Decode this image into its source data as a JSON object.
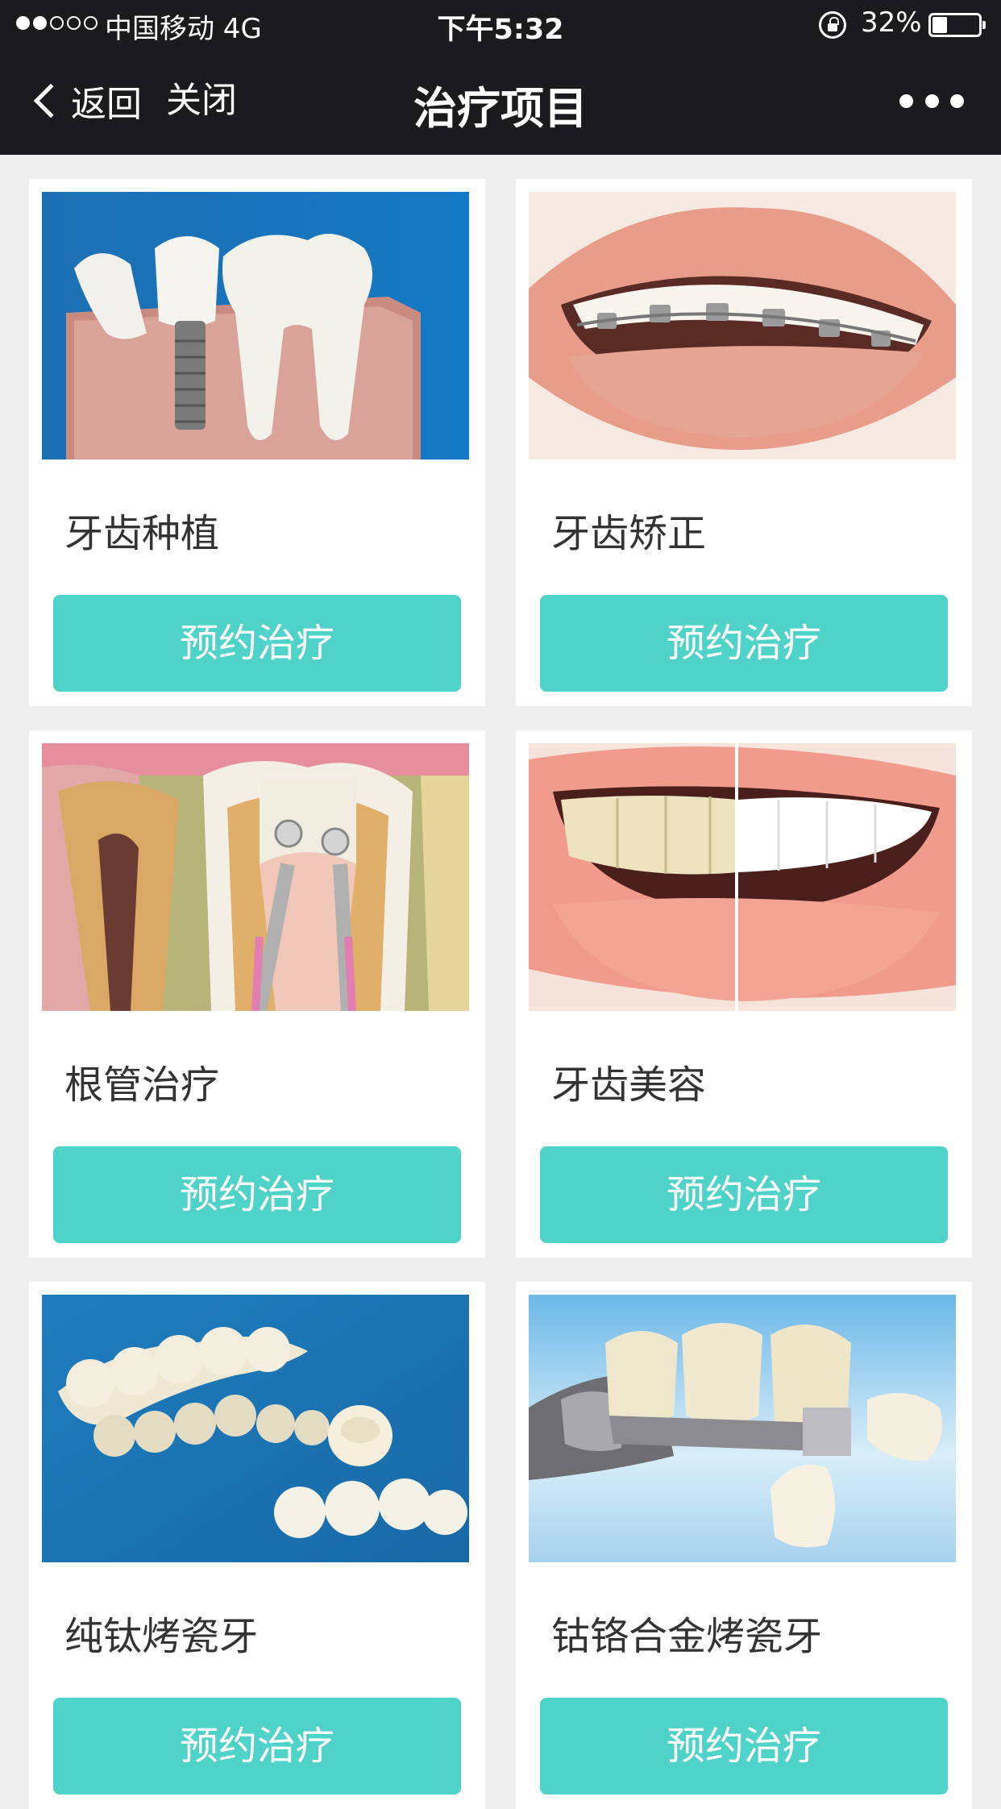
{
  "status_bar": {
    "carrier": "中国移动   4G",
    "time": "下午5:32",
    "battery": "32%",
    "battery_level": 0.32
  },
  "nav": {
    "back_label": "返回",
    "close_label": "关闭",
    "title": "治疗项目"
  },
  "colors": {
    "nav_background": "#1b1b1f",
    "page_background": "#efefef",
    "button_accent": "#4fd3c8"
  },
  "items": [
    {
      "title": "牙齿种植",
      "button_label": "预约治疗"
    },
    {
      "title": "牙齿矫正",
      "button_label": "预约治疗"
    },
    {
      "title": "根管治疗",
      "button_label": "预约治疗"
    },
    {
      "title": "牙齿美容",
      "button_label": "预约治疗"
    },
    {
      "title": "纯钛烤瓷牙",
      "button_label": "预约治疗"
    },
    {
      "title": "钴铬合金烤瓷牙",
      "button_label": "预约治疗"
    }
  ]
}
